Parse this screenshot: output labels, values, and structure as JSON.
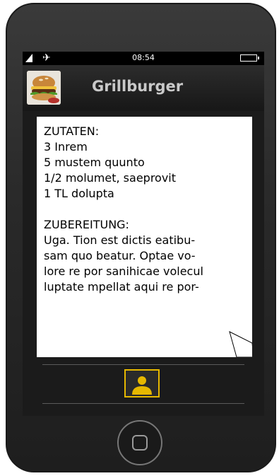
{
  "status_bar": {
    "time": "08:54",
    "airplane_icon": "airplane-icon",
    "signal_icon": "signal-icon",
    "battery_icon": "battery-icon"
  },
  "header": {
    "title": "Grillburger",
    "thumbnail_icon": "burger-image"
  },
  "recipe": {
    "ingredients_heading": "ZUTATEN:",
    "ingredients": [
      "3 Inrem",
      "5 mustem quunto",
      "1/2 molumet, saeprovit",
      "1 TL dolupta"
    ],
    "preparation_heading": "ZUBEREITUNG:",
    "preparation_lines": [
      "Uga. Tion est dictis eatibu-",
      "sam quo beatur. Optae vo-",
      "lore re por sanihicae volecul",
      "luptate mpellat aqui re por-"
    ]
  },
  "bottom_bar": {
    "profile_icon": "person-icon",
    "accent_color": "#e6b800"
  },
  "hardware": {
    "home_button_icon": "home-button-icon"
  }
}
